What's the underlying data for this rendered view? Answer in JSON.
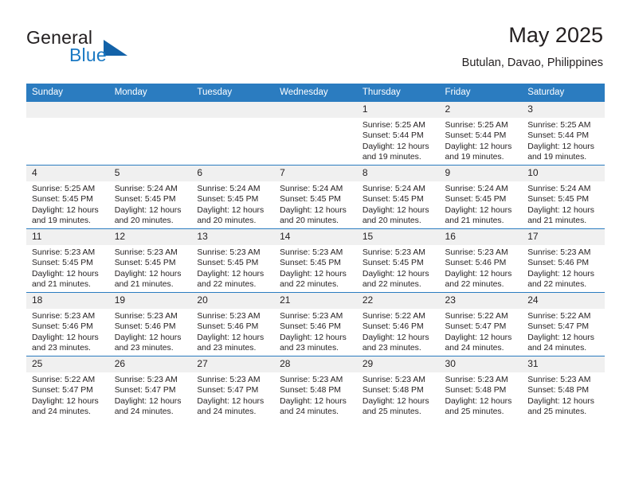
{
  "brand": {
    "name_part1": "General",
    "name_part2": "Blue",
    "logo_icon": "triangle-flag-icon",
    "accent_color": "#1362a8",
    "blue_text_color": "#1b79c3"
  },
  "header": {
    "title": "May 2025",
    "subtitle": "Butulan, Davao, Philippines"
  },
  "theme": {
    "header_bg": "#2b7cc0",
    "daynum_bg": "#f0f0f0",
    "text_color": "#231f20"
  },
  "weekdays": [
    "Sunday",
    "Monday",
    "Tuesday",
    "Wednesday",
    "Thursday",
    "Friday",
    "Saturday"
  ],
  "weeks": [
    [
      {
        "day": "",
        "empty": true,
        "sunrise": "",
        "sunset": "",
        "daylight1": "",
        "daylight2": ""
      },
      {
        "day": "",
        "empty": true,
        "sunrise": "",
        "sunset": "",
        "daylight1": "",
        "daylight2": ""
      },
      {
        "day": "",
        "empty": true,
        "sunrise": "",
        "sunset": "",
        "daylight1": "",
        "daylight2": ""
      },
      {
        "day": "",
        "empty": true,
        "sunrise": "",
        "sunset": "",
        "daylight1": "",
        "daylight2": ""
      },
      {
        "day": "1",
        "empty": false,
        "sunrise": "Sunrise: 5:25 AM",
        "sunset": "Sunset: 5:44 PM",
        "daylight1": "Daylight: 12 hours",
        "daylight2": "and 19 minutes."
      },
      {
        "day": "2",
        "empty": false,
        "sunrise": "Sunrise: 5:25 AM",
        "sunset": "Sunset: 5:44 PM",
        "daylight1": "Daylight: 12 hours",
        "daylight2": "and 19 minutes."
      },
      {
        "day": "3",
        "empty": false,
        "sunrise": "Sunrise: 5:25 AM",
        "sunset": "Sunset: 5:44 PM",
        "daylight1": "Daylight: 12 hours",
        "daylight2": "and 19 minutes."
      }
    ],
    [
      {
        "day": "4",
        "empty": false,
        "sunrise": "Sunrise: 5:25 AM",
        "sunset": "Sunset: 5:45 PM",
        "daylight1": "Daylight: 12 hours",
        "daylight2": "and 19 minutes."
      },
      {
        "day": "5",
        "empty": false,
        "sunrise": "Sunrise: 5:24 AM",
        "sunset": "Sunset: 5:45 PM",
        "daylight1": "Daylight: 12 hours",
        "daylight2": "and 20 minutes."
      },
      {
        "day": "6",
        "empty": false,
        "sunrise": "Sunrise: 5:24 AM",
        "sunset": "Sunset: 5:45 PM",
        "daylight1": "Daylight: 12 hours",
        "daylight2": "and 20 minutes."
      },
      {
        "day": "7",
        "empty": false,
        "sunrise": "Sunrise: 5:24 AM",
        "sunset": "Sunset: 5:45 PM",
        "daylight1": "Daylight: 12 hours",
        "daylight2": "and 20 minutes."
      },
      {
        "day": "8",
        "empty": false,
        "sunrise": "Sunrise: 5:24 AM",
        "sunset": "Sunset: 5:45 PM",
        "daylight1": "Daylight: 12 hours",
        "daylight2": "and 20 minutes."
      },
      {
        "day": "9",
        "empty": false,
        "sunrise": "Sunrise: 5:24 AM",
        "sunset": "Sunset: 5:45 PM",
        "daylight1": "Daylight: 12 hours",
        "daylight2": "and 21 minutes."
      },
      {
        "day": "10",
        "empty": false,
        "sunrise": "Sunrise: 5:24 AM",
        "sunset": "Sunset: 5:45 PM",
        "daylight1": "Daylight: 12 hours",
        "daylight2": "and 21 minutes."
      }
    ],
    [
      {
        "day": "11",
        "empty": false,
        "sunrise": "Sunrise: 5:23 AM",
        "sunset": "Sunset: 5:45 PM",
        "daylight1": "Daylight: 12 hours",
        "daylight2": "and 21 minutes."
      },
      {
        "day": "12",
        "empty": false,
        "sunrise": "Sunrise: 5:23 AM",
        "sunset": "Sunset: 5:45 PM",
        "daylight1": "Daylight: 12 hours",
        "daylight2": "and 21 minutes."
      },
      {
        "day": "13",
        "empty": false,
        "sunrise": "Sunrise: 5:23 AM",
        "sunset": "Sunset: 5:45 PM",
        "daylight1": "Daylight: 12 hours",
        "daylight2": "and 22 minutes."
      },
      {
        "day": "14",
        "empty": false,
        "sunrise": "Sunrise: 5:23 AM",
        "sunset": "Sunset: 5:45 PM",
        "daylight1": "Daylight: 12 hours",
        "daylight2": "and 22 minutes."
      },
      {
        "day": "15",
        "empty": false,
        "sunrise": "Sunrise: 5:23 AM",
        "sunset": "Sunset: 5:45 PM",
        "daylight1": "Daylight: 12 hours",
        "daylight2": "and 22 minutes."
      },
      {
        "day": "16",
        "empty": false,
        "sunrise": "Sunrise: 5:23 AM",
        "sunset": "Sunset: 5:46 PM",
        "daylight1": "Daylight: 12 hours",
        "daylight2": "and 22 minutes."
      },
      {
        "day": "17",
        "empty": false,
        "sunrise": "Sunrise: 5:23 AM",
        "sunset": "Sunset: 5:46 PM",
        "daylight1": "Daylight: 12 hours",
        "daylight2": "and 22 minutes."
      }
    ],
    [
      {
        "day": "18",
        "empty": false,
        "sunrise": "Sunrise: 5:23 AM",
        "sunset": "Sunset: 5:46 PM",
        "daylight1": "Daylight: 12 hours",
        "daylight2": "and 23 minutes."
      },
      {
        "day": "19",
        "empty": false,
        "sunrise": "Sunrise: 5:23 AM",
        "sunset": "Sunset: 5:46 PM",
        "daylight1": "Daylight: 12 hours",
        "daylight2": "and 23 minutes."
      },
      {
        "day": "20",
        "empty": false,
        "sunrise": "Sunrise: 5:23 AM",
        "sunset": "Sunset: 5:46 PM",
        "daylight1": "Daylight: 12 hours",
        "daylight2": "and 23 minutes."
      },
      {
        "day": "21",
        "empty": false,
        "sunrise": "Sunrise: 5:23 AM",
        "sunset": "Sunset: 5:46 PM",
        "daylight1": "Daylight: 12 hours",
        "daylight2": "and 23 minutes."
      },
      {
        "day": "22",
        "empty": false,
        "sunrise": "Sunrise: 5:22 AM",
        "sunset": "Sunset: 5:46 PM",
        "daylight1": "Daylight: 12 hours",
        "daylight2": "and 23 minutes."
      },
      {
        "day": "23",
        "empty": false,
        "sunrise": "Sunrise: 5:22 AM",
        "sunset": "Sunset: 5:47 PM",
        "daylight1": "Daylight: 12 hours",
        "daylight2": "and 24 minutes."
      },
      {
        "day": "24",
        "empty": false,
        "sunrise": "Sunrise: 5:22 AM",
        "sunset": "Sunset: 5:47 PM",
        "daylight1": "Daylight: 12 hours",
        "daylight2": "and 24 minutes."
      }
    ],
    [
      {
        "day": "25",
        "empty": false,
        "sunrise": "Sunrise: 5:22 AM",
        "sunset": "Sunset: 5:47 PM",
        "daylight1": "Daylight: 12 hours",
        "daylight2": "and 24 minutes."
      },
      {
        "day": "26",
        "empty": false,
        "sunrise": "Sunrise: 5:23 AM",
        "sunset": "Sunset: 5:47 PM",
        "daylight1": "Daylight: 12 hours",
        "daylight2": "and 24 minutes."
      },
      {
        "day": "27",
        "empty": false,
        "sunrise": "Sunrise: 5:23 AM",
        "sunset": "Sunset: 5:47 PM",
        "daylight1": "Daylight: 12 hours",
        "daylight2": "and 24 minutes."
      },
      {
        "day": "28",
        "empty": false,
        "sunrise": "Sunrise: 5:23 AM",
        "sunset": "Sunset: 5:48 PM",
        "daylight1": "Daylight: 12 hours",
        "daylight2": "and 24 minutes."
      },
      {
        "day": "29",
        "empty": false,
        "sunrise": "Sunrise: 5:23 AM",
        "sunset": "Sunset: 5:48 PM",
        "daylight1": "Daylight: 12 hours",
        "daylight2": "and 25 minutes."
      },
      {
        "day": "30",
        "empty": false,
        "sunrise": "Sunrise: 5:23 AM",
        "sunset": "Sunset: 5:48 PM",
        "daylight1": "Daylight: 12 hours",
        "daylight2": "and 25 minutes."
      },
      {
        "day": "31",
        "empty": false,
        "sunrise": "Sunrise: 5:23 AM",
        "sunset": "Sunset: 5:48 PM",
        "daylight1": "Daylight: 12 hours",
        "daylight2": "and 25 minutes."
      }
    ]
  ]
}
